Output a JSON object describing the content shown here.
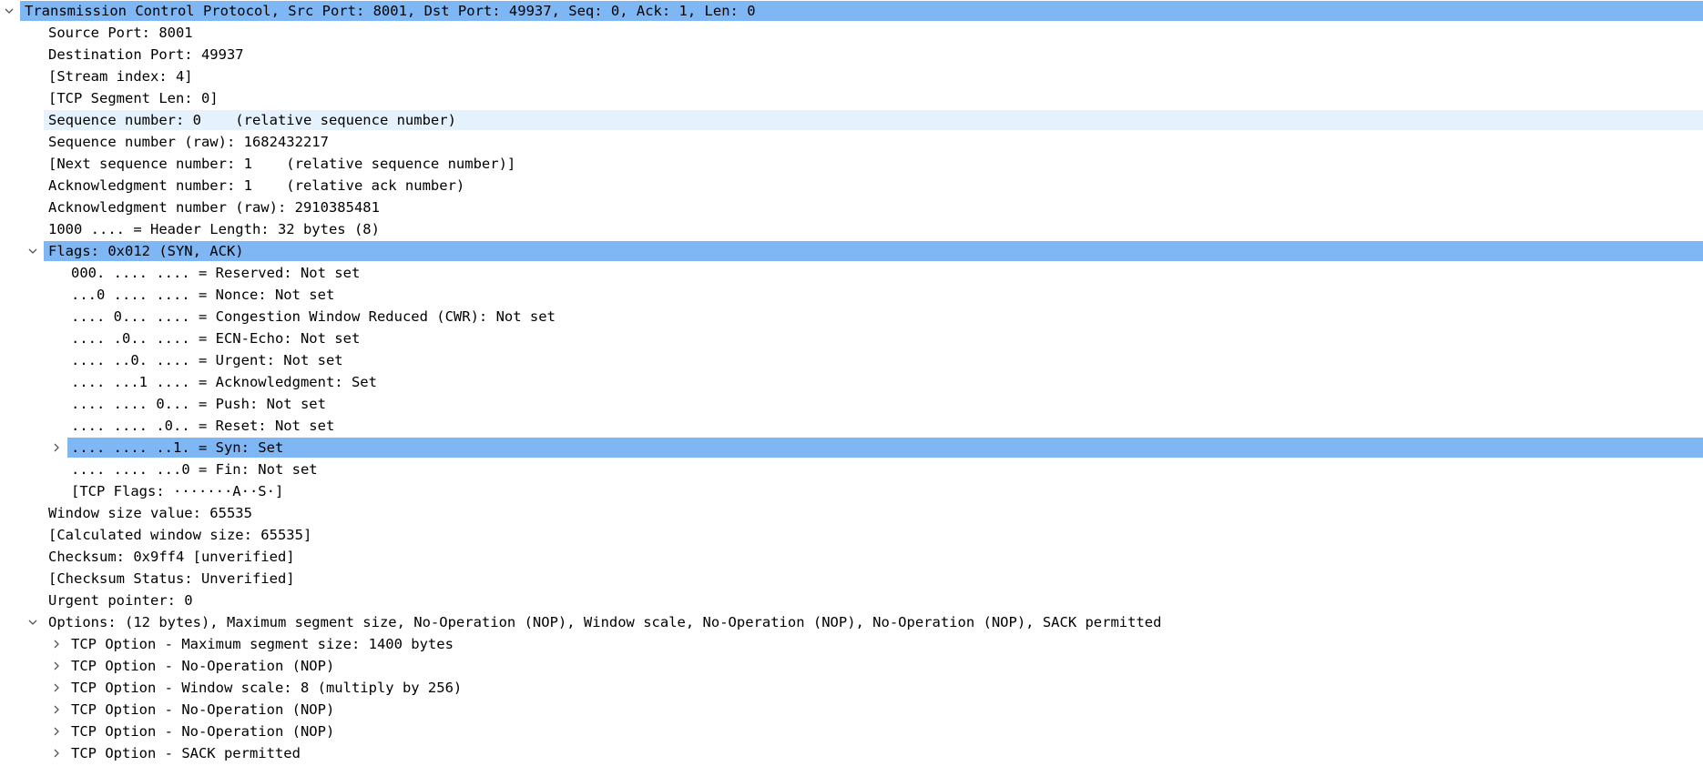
{
  "colors": {
    "selected_bg": "#7fb6f4",
    "related_bg": "#e5f1fc",
    "text": "#000000",
    "arrow": "#555555"
  },
  "rows": [
    {
      "depth": 0,
      "expander": "expanded",
      "highlight": "selected",
      "text": "Transmission Control Protocol, Src Port: 8001, Dst Port: 49937, Seq: 0, Ack: 1, Len: 0"
    },
    {
      "depth": 1,
      "expander": "none",
      "highlight": "none",
      "text": "Source Port: 8001"
    },
    {
      "depth": 1,
      "expander": "none",
      "highlight": "none",
      "text": "Destination Port: 49937"
    },
    {
      "depth": 1,
      "expander": "none",
      "highlight": "none",
      "text": "[Stream index: 4]"
    },
    {
      "depth": 1,
      "expander": "none",
      "highlight": "none",
      "text": "[TCP Segment Len: 0]"
    },
    {
      "depth": 1,
      "expander": "none",
      "highlight": "related",
      "text": "Sequence number: 0    (relative sequence number)"
    },
    {
      "depth": 1,
      "expander": "none",
      "highlight": "none",
      "text": "Sequence number (raw): 1682432217"
    },
    {
      "depth": 1,
      "expander": "none",
      "highlight": "none",
      "text": "[Next sequence number: 1    (relative sequence number)]"
    },
    {
      "depth": 1,
      "expander": "none",
      "highlight": "none",
      "text": "Acknowledgment number: 1    (relative ack number)"
    },
    {
      "depth": 1,
      "expander": "none",
      "highlight": "none",
      "text": "Acknowledgment number (raw): 2910385481"
    },
    {
      "depth": 1,
      "expander": "none",
      "highlight": "none",
      "text": "1000 .... = Header Length: 32 bytes (8)"
    },
    {
      "depth": 1,
      "expander": "expanded",
      "highlight": "selected",
      "text": "Flags: 0x012 (SYN, ACK)"
    },
    {
      "depth": 2,
      "expander": "none",
      "highlight": "none",
      "text": "000. .... .... = Reserved: Not set"
    },
    {
      "depth": 2,
      "expander": "none",
      "highlight": "none",
      "text": "...0 .... .... = Nonce: Not set"
    },
    {
      "depth": 2,
      "expander": "none",
      "highlight": "none",
      "text": ".... 0... .... = Congestion Window Reduced (CWR): Not set"
    },
    {
      "depth": 2,
      "expander": "none",
      "highlight": "none",
      "text": ".... .0.. .... = ECN-Echo: Not set"
    },
    {
      "depth": 2,
      "expander": "none",
      "highlight": "none",
      "text": ".... ..0. .... = Urgent: Not set"
    },
    {
      "depth": 2,
      "expander": "none",
      "highlight": "none",
      "text": ".... ...1 .... = Acknowledgment: Set"
    },
    {
      "depth": 2,
      "expander": "none",
      "highlight": "none",
      "text": ".... .... 0... = Push: Not set"
    },
    {
      "depth": 2,
      "expander": "none",
      "highlight": "none",
      "text": ".... .... .0.. = Reset: Not set"
    },
    {
      "depth": 2,
      "expander": "collapsed",
      "highlight": "selected",
      "text": ".... .... ..1. = Syn: Set"
    },
    {
      "depth": 2,
      "expander": "none",
      "highlight": "none",
      "text": ".... .... ...0 = Fin: Not set"
    },
    {
      "depth": 2,
      "expander": "none",
      "highlight": "none",
      "text": "[TCP Flags: ·······A··S·]"
    },
    {
      "depth": 1,
      "expander": "none",
      "highlight": "none",
      "text": "Window size value: 65535"
    },
    {
      "depth": 1,
      "expander": "none",
      "highlight": "none",
      "text": "[Calculated window size: 65535]"
    },
    {
      "depth": 1,
      "expander": "none",
      "highlight": "none",
      "text": "Checksum: 0x9ff4 [unverified]"
    },
    {
      "depth": 1,
      "expander": "none",
      "highlight": "none",
      "text": "[Checksum Status: Unverified]"
    },
    {
      "depth": 1,
      "expander": "none",
      "highlight": "none",
      "text": "Urgent pointer: 0"
    },
    {
      "depth": 1,
      "expander": "expanded",
      "highlight": "none",
      "text": "Options: (12 bytes), Maximum segment size, No-Operation (NOP), Window scale, No-Operation (NOP), No-Operation (NOP), SACK permitted"
    },
    {
      "depth": 2,
      "expander": "collapsed",
      "highlight": "none",
      "text": "TCP Option - Maximum segment size: 1400 bytes"
    },
    {
      "depth": 2,
      "expander": "collapsed",
      "highlight": "none",
      "text": "TCP Option - No-Operation (NOP)"
    },
    {
      "depth": 2,
      "expander": "collapsed",
      "highlight": "none",
      "text": "TCP Option - Window scale: 8 (multiply by 256)"
    },
    {
      "depth": 2,
      "expander": "collapsed",
      "highlight": "none",
      "text": "TCP Option - No-Operation (NOP)"
    },
    {
      "depth": 2,
      "expander": "collapsed",
      "highlight": "none",
      "text": "TCP Option - No-Operation (NOP)"
    },
    {
      "depth": 2,
      "expander": "collapsed",
      "highlight": "none",
      "text": "TCP Option - SACK permitted"
    }
  ]
}
